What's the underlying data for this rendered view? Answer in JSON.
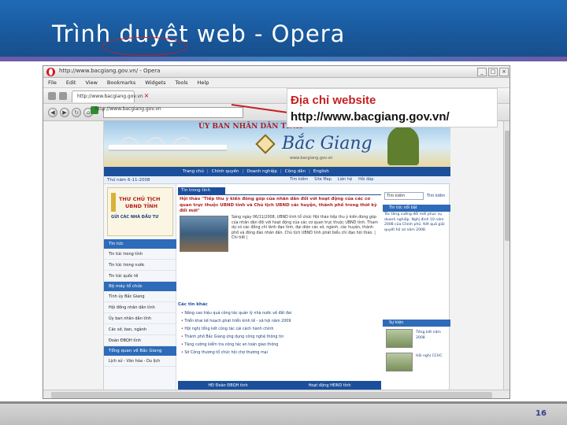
{
  "slide": {
    "title": "Trình duyệt web - Opera",
    "page_number": "16",
    "colors": {
      "header_blue": "#1a5a9e",
      "callout_red": "#c62020",
      "footer_gray": "#c8c8c8"
    }
  },
  "browser": {
    "window_title": "http://www.bacgiang.gov.vn/ - Opera",
    "logo_icon": "opera-logo-icon",
    "menu": [
      "File",
      "Edit",
      "View",
      "Bookmarks",
      "Widgets",
      "Tools",
      "Help"
    ],
    "tab_title": "http://www.bacgiang.gov.vn",
    "address": "http://www.bacgiang.gov.vn",
    "window_controls": [
      "_",
      "□",
      "×"
    ]
  },
  "callout": {
    "label": "Địa chỉ website",
    "url": "http://www.bacgiang.gov.vn/"
  },
  "site": {
    "org": "ỦY BAN NHÂN DÂN TỈNH",
    "name": "Bắc Giang",
    "banner_url": "www.bacgiang.gov.vn",
    "nav": [
      "Trang chủ",
      "Chính quyền",
      "Doanh nghiệp",
      "Công dân",
      "English"
    ],
    "date": "Thứ năm 6-11-2008",
    "util_links": [
      "Tìm kiếm",
      "Site Map",
      "Liên hệ",
      "Hỏi đáp"
    ],
    "promo": {
      "line1": "THƯ CHỦ TỊCH",
      "line2": "UBND TỈNH",
      "line3": "GỬI CÁC NHÀ ĐẦU TƯ"
    },
    "side_menu": [
      {
        "type": "header",
        "label": "Tin tức"
      },
      {
        "type": "item",
        "label": "Tin tức trong tỉnh"
      },
      {
        "type": "item",
        "label": "Tin tức trong nước"
      },
      {
        "type": "item",
        "label": "Tin tức quốc tế"
      },
      {
        "type": "header",
        "label": "Bộ máy tổ chức"
      },
      {
        "type": "item",
        "label": "Tỉnh ủy Bắc Giang"
      },
      {
        "type": "item",
        "label": "Hội đồng nhân dân tỉnh"
      },
      {
        "type": "item",
        "label": "Ủy ban nhân dân tỉnh"
      },
      {
        "type": "item",
        "label": "Các sở, ban, ngành"
      },
      {
        "type": "item",
        "label": "Đoàn ĐBQH tỉnh"
      },
      {
        "type": "header",
        "label": "Tổng quan về Bắc Giang"
      },
      {
        "type": "item",
        "label": "Lịch sử - Văn hóa - Du lịch"
      }
    ],
    "main": {
      "section": "Tin trong tỉnh",
      "headline": "Hội thảo \"Tiếp thu ý kiến đóng góp của nhân dân đối với hoạt động của các cơ quan trực thuộc UBND tỉnh và Chủ tịch UBND các huyện, thành phố trong thời kỳ đổi mới\"",
      "body": "Sáng ngày 06/11/2008, UBND tỉnh tổ chức Hội thảo tiếp thu ý kiến đóng góp của nhân dân đối với hoạt động của các cơ quan trực thuộc UBND tỉnh. Tham dự có các đồng chí lãnh đạo tỉnh, đại diện các sở, ngành, các huyện, thành phố và đông đảo nhân dân. Chủ tịch UBND tỉnh phát biểu chỉ đạo hội thảo.",
      "detail_link": "| Chi tiết |",
      "other_head": "Các tin khác",
      "other_news": [
        "Nâng cao hiệu quả công tác quản lý nhà nước về đất đai",
        "Triển khai kế hoạch phát triển kinh tế - xã hội năm 2009",
        "Hội nghị tổng kết công tác cải cách hành chính",
        "Thành phố Bắc Giang ứng dụng công nghệ thông tin",
        "Tăng cường kiểm tra công tác an toàn giao thông",
        "Sở Công thương tổ chức hội chợ thương mại"
      ],
      "footer_links": [
        "HĐ Đoàn ĐBQH tỉnh",
        "Hoạt động HĐND tỉnh"
      ]
    },
    "right": {
      "search_placeholder": "Tìm kiếm",
      "search_button": "Tìm kiếm",
      "notice_head": "Tin tức nổi bật",
      "notice_body": "Tóc tăng cường đổi mới phục vụ doanh nghiệp. Nghị định 10 năm 2008 của Chính phủ. Kết quả giải quyết hồ sơ năm 2008.",
      "event_head": "Sự kiện",
      "events": [
        "Tổng kết năm 2008",
        "Hội nghị CCHC"
      ]
    }
  }
}
